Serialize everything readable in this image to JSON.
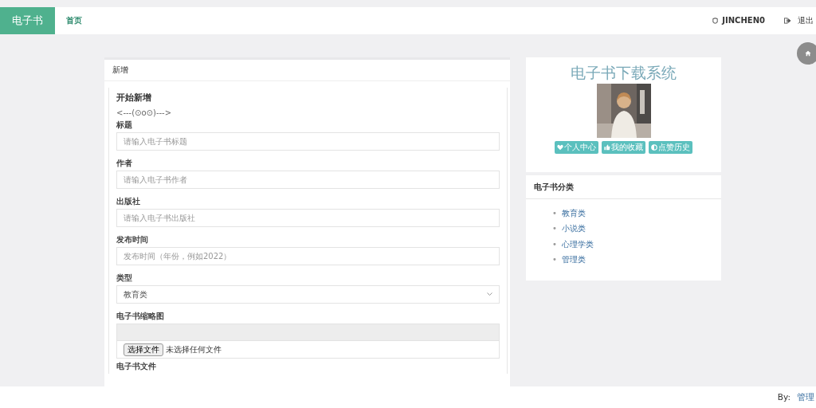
{
  "navbar": {
    "brand": "电子书",
    "links": [
      {
        "label": "首页",
        "selected": true
      }
    ],
    "user": "JINCHEN0",
    "logout": "退出"
  },
  "form_card": {
    "header": "新增",
    "title": "开始新增",
    "subtitle": "<---(⊙o⊙)--->",
    "fields": [
      {
        "kind": "text",
        "label": "标题",
        "placeholder": "请输入电子书标题"
      },
      {
        "kind": "text",
        "label": "作者",
        "placeholder": "请输入电子书作者"
      },
      {
        "kind": "text",
        "label": "出版社",
        "placeholder": "请输入电子书出版社"
      },
      {
        "kind": "text",
        "label": "发布时间",
        "placeholder": "发布时间（年份，例如2022）"
      },
      {
        "kind": "select",
        "label": "类型",
        "value": "教育类"
      },
      {
        "kind": "file",
        "label": "电子书缩略图",
        "button": "选择文件",
        "status": "未选择任何文件"
      },
      {
        "kind": "label",
        "label": "电子书文件"
      }
    ]
  },
  "profile_card": {
    "title": "电子书下载系统",
    "buttons": [
      {
        "kind": "heart",
        "label": "个人中心"
      },
      {
        "kind": "thumb",
        "label": "我的收藏"
      },
      {
        "kind": "half",
        "label": "点赞历史"
      }
    ]
  },
  "category_card": {
    "header": "电子书分类",
    "marker": "•",
    "items": [
      "教育类",
      "小说类",
      "心理学类",
      "管理类"
    ]
  },
  "footer": {
    "by": "By:",
    "author": "管理"
  }
}
